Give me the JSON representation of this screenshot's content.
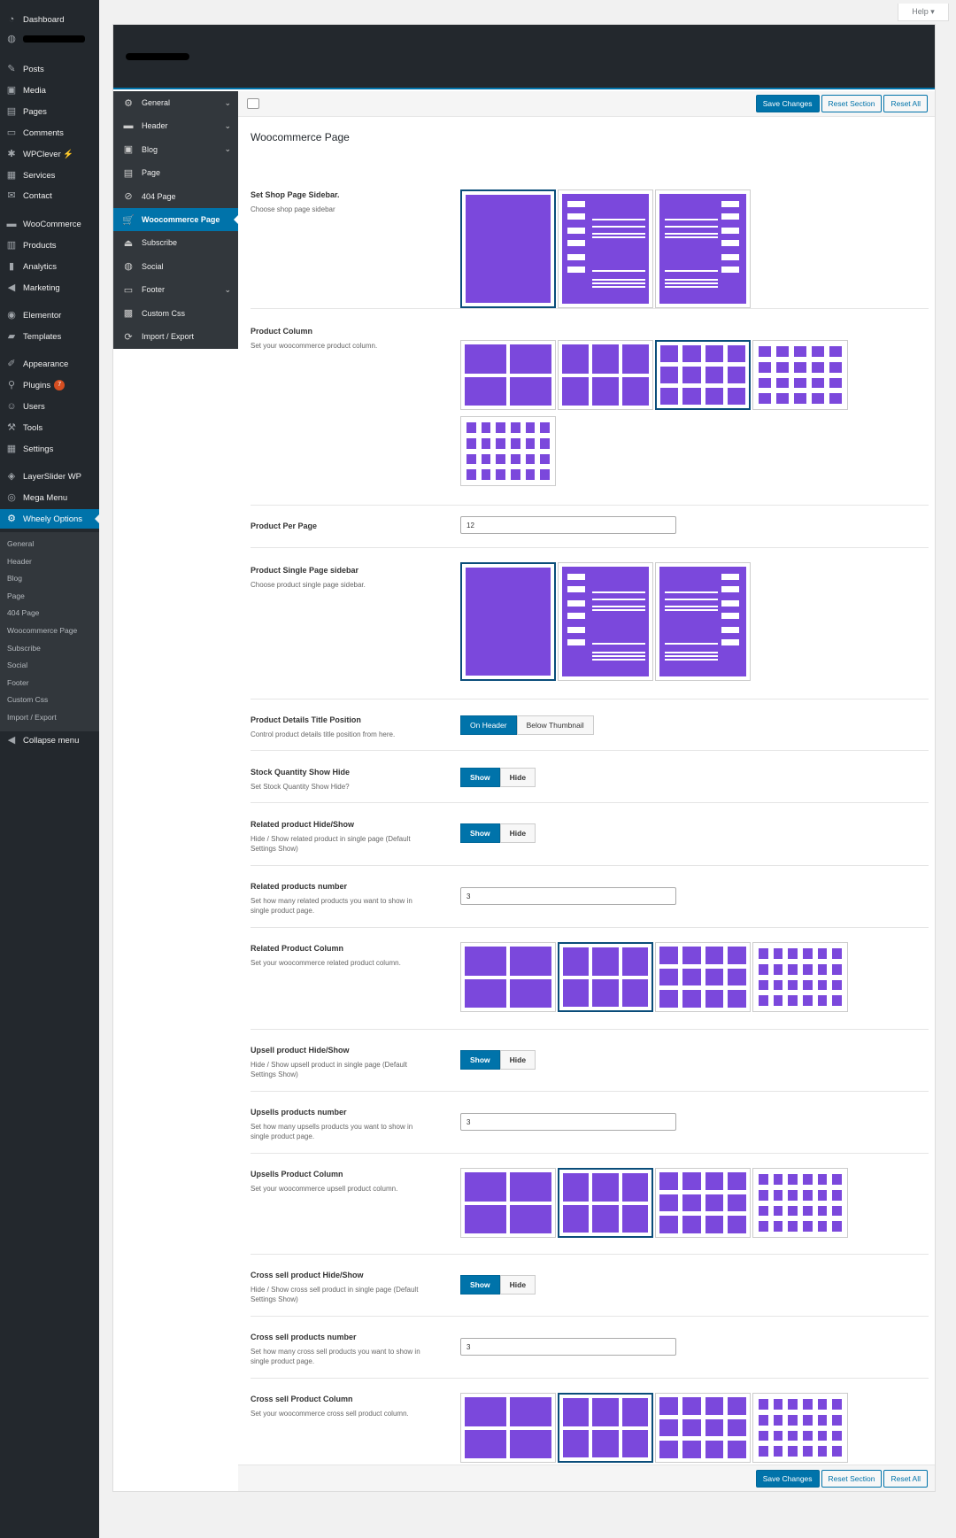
{
  "admin_menu": {
    "items": [
      {
        "label": "Dashboard",
        "icon": "dashboard-icon",
        "glyph": "◔"
      },
      {
        "label": "",
        "icon": "site-icon",
        "glyph": "◍",
        "redacted": true
      },
      {
        "label": "Posts",
        "icon": "pin-icon",
        "glyph": "✎"
      },
      {
        "label": "Media",
        "icon": "media-icon",
        "glyph": "▣"
      },
      {
        "label": "Pages",
        "icon": "pages-icon",
        "glyph": "▤"
      },
      {
        "label": "Comments",
        "icon": "comments-icon",
        "glyph": "▭"
      },
      {
        "label": "WPClever ⚡",
        "icon": "wpclever-icon",
        "glyph": "✱"
      },
      {
        "label": "Services",
        "icon": "services-icon",
        "glyph": "▦"
      },
      {
        "label": "Contact",
        "icon": "contact-icon",
        "glyph": "✉"
      },
      {
        "label": "WooCommerce",
        "icon": "woocommerce-icon",
        "glyph": "▬"
      },
      {
        "label": "Products",
        "icon": "products-icon",
        "glyph": "▥"
      },
      {
        "label": "Analytics",
        "icon": "analytics-icon",
        "glyph": "▮"
      },
      {
        "label": "Marketing",
        "icon": "marketing-icon",
        "glyph": "◀"
      },
      {
        "label": "Elementor",
        "icon": "elementor-icon",
        "glyph": "◉"
      },
      {
        "label": "Templates",
        "icon": "templates-icon",
        "glyph": "▰"
      },
      {
        "label": "Appearance",
        "icon": "appearance-icon",
        "glyph": "✐"
      },
      {
        "label": "Plugins",
        "icon": "plugins-icon",
        "glyph": "⚲",
        "badge": "7"
      },
      {
        "label": "Users",
        "icon": "users-icon",
        "glyph": "☺"
      },
      {
        "label": "Tools",
        "icon": "tools-icon",
        "glyph": "⚒"
      },
      {
        "label": "Settings",
        "icon": "settings-icon",
        "glyph": "▦"
      },
      {
        "label": "LayerSlider WP",
        "icon": "layerslider-icon",
        "glyph": "◈"
      },
      {
        "label": "Mega Menu",
        "icon": "mega-menu-icon",
        "glyph": "◎"
      },
      {
        "label": "Wheely Options",
        "icon": "gear-icon",
        "glyph": "⚙",
        "active": true
      }
    ],
    "submenu": [
      "General",
      "Header",
      "Blog",
      "Page",
      "404 Page",
      "Woocommerce Page",
      "Subscribe",
      "Social",
      "Footer",
      "Custom Css",
      "Import / Export"
    ],
    "collapse_label": "Collapse menu"
  },
  "help_label": "Help ▾",
  "options_nav": [
    {
      "label": "General",
      "icon": "gear-icon",
      "glyph": "⚙",
      "chevron": true
    },
    {
      "label": "Header",
      "icon": "header-icon",
      "glyph": "▬",
      "chevron": true
    },
    {
      "label": "Blog",
      "icon": "blog-icon",
      "glyph": "▣",
      "chevron": true
    },
    {
      "label": "Page",
      "icon": "page-icon",
      "glyph": "▤"
    },
    {
      "label": "404 Page",
      "icon": "forbidden-icon",
      "glyph": "⊘"
    },
    {
      "label": "Woocommerce Page",
      "icon": "cart-icon",
      "glyph": "🛒",
      "active": true
    },
    {
      "label": "Subscribe",
      "icon": "eject-icon",
      "glyph": "⏏"
    },
    {
      "label": "Social",
      "icon": "globe-icon",
      "glyph": "◍"
    },
    {
      "label": "Footer",
      "icon": "footer-icon",
      "glyph": "▭",
      "chevron": true
    },
    {
      "label": "Custom Css",
      "icon": "css-icon",
      "glyph": "▩"
    },
    {
      "label": "Import / Export",
      "icon": "refresh-icon",
      "glyph": "⟳"
    }
  ],
  "toolbar": {
    "save": "Save Changes",
    "reset_section": "Reset Section",
    "reset_all": "Reset All"
  },
  "section_title": "Woocommerce Page",
  "fields": {
    "shop_sidebar": {
      "label": "Set Shop Page Sidebar.",
      "desc": "Choose shop page sidebar"
    },
    "product_column": {
      "label": "Product Column",
      "desc": "Set your woocommerce product column."
    },
    "per_page": {
      "label": "Product Per Page",
      "value": "12"
    },
    "single_sidebar": {
      "label": "Product Single Page sidebar",
      "desc": "Choose product single page sidebar."
    },
    "title_position": {
      "label": "Product Details Title Position",
      "desc": "Control product details title position from here.",
      "options": [
        "On Header",
        "Below Thumbnail"
      ]
    },
    "stock": {
      "label": "Stock Quantity Show Hide",
      "desc": "Set Stock Quantity Show Hide?",
      "on": "Show",
      "off": "Hide"
    },
    "related_toggle": {
      "label": "Related product Hide/Show",
      "desc": "Hide / Show related product in single page (Default Settings Show)",
      "on": "Show",
      "off": "Hide"
    },
    "related_number": {
      "label": "Related products number",
      "desc": "Set how many related products you want to show in single product page.",
      "value": "3"
    },
    "related_column": {
      "label": "Related Product Column",
      "desc": "Set your woocommerce related product column."
    },
    "upsell_toggle": {
      "label": "Upsell product Hide/Show",
      "desc": "Hide / Show upsell product in single page (Default Settings Show)",
      "on": "Show",
      "off": "Hide"
    },
    "upsell_number": {
      "label": "Upsells products number",
      "desc": "Set how many upsells products you want to show in single product page.",
      "value": "3"
    },
    "upsell_column": {
      "label": "Upsells Product Column",
      "desc": "Set your woocommerce upsell product column."
    },
    "cross_toggle": {
      "label": "Cross sell product Hide/Show",
      "desc": "Hide / Show cross sell product in single page (Default Settings Show)",
      "on": "Show",
      "off": "Hide"
    },
    "cross_number": {
      "label": "Cross sell products number",
      "desc": "Set how many cross sell products you want to show in single product page.",
      "value": "3"
    },
    "cross_column": {
      "label": "Cross sell Product Column",
      "desc": "Set your woocommerce cross sell product column."
    }
  },
  "accent_color": "#7b48dc",
  "primary_color": "#0073aa"
}
